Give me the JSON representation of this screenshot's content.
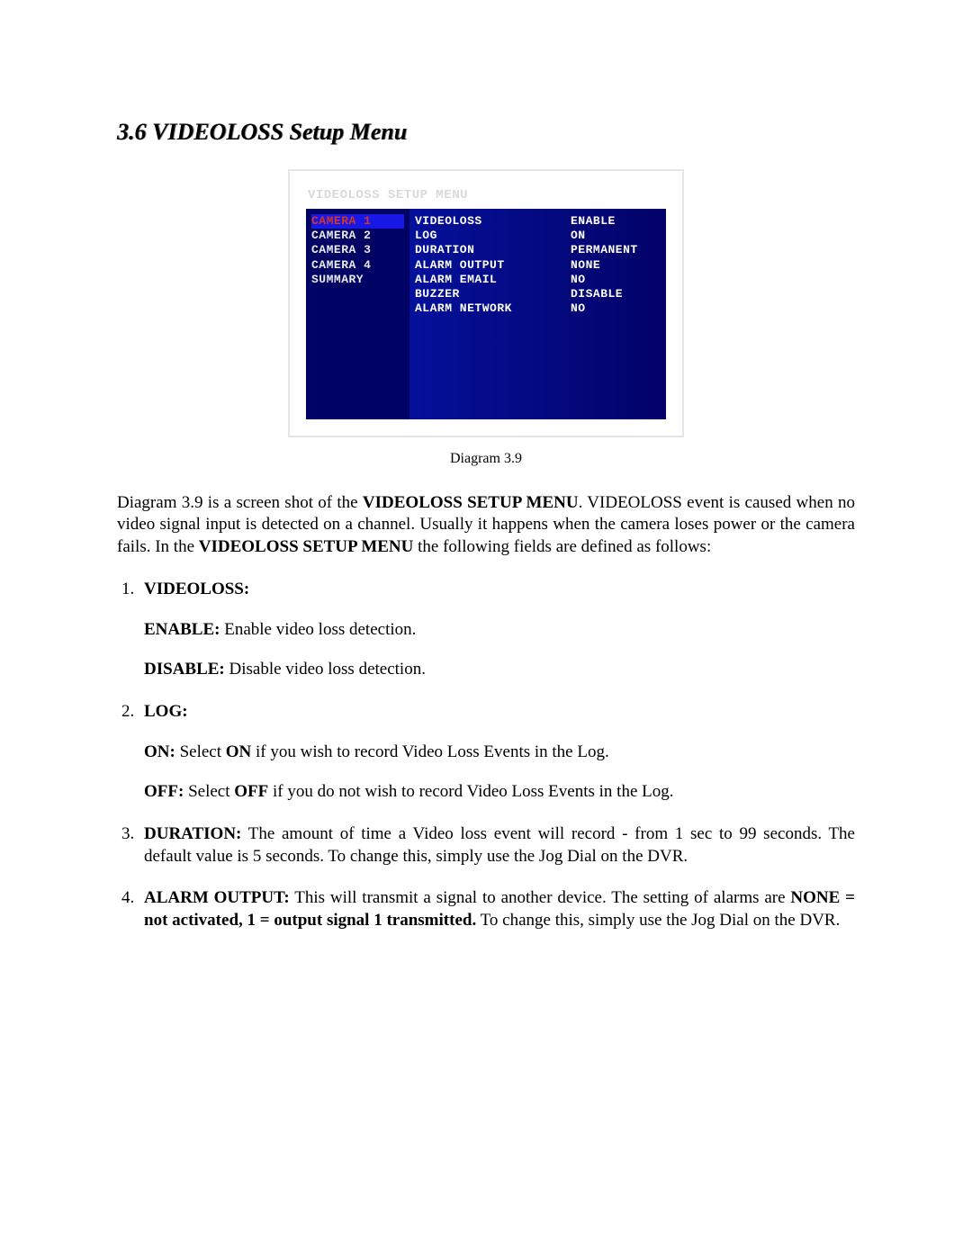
{
  "heading": "3.6 VIDEOLOSS Setup Menu",
  "menu": {
    "title": "VIDEOLOSS SETUP MENU",
    "left": [
      "CAMERA 1",
      "CAMERA 2",
      "CAMERA 3",
      "CAMERA 4",
      "SUMMARY"
    ],
    "rows": [
      {
        "field": "VIDEOLOSS",
        "value": "ENABLE"
      },
      {
        "field": "LOG",
        "value": "ON"
      },
      {
        "field": "DURATION",
        "value": "PERMANENT"
      },
      {
        "field": "ALARM OUTPUT",
        "value": "NONE"
      },
      {
        "field": "ALARM EMAIL",
        "value": "NO"
      },
      {
        "field": "BUZZER",
        "value": "DISABLE"
      },
      {
        "field": "ALARM NETWORK",
        "value": "NO"
      }
    ]
  },
  "caption": "Diagram 3.9",
  "intro": {
    "pre": "Diagram 3.9 is a screen shot of the ",
    "b1": "VIDEOLOSS SETUP MENU",
    "mid": ". VIDEOLOSS event is caused when no video signal input is detected on a channel. Usually it happens when the camera loses power or the camera fails. In the ",
    "b2": "VIDEOLOSS SETUP MENU",
    "post": " the following fields are defined as follows:"
  },
  "items": {
    "item1": {
      "title": "VIDEOLOSS:",
      "enable_label": "ENABLE:",
      "enable_text": " Enable video loss detection.",
      "disable_label": "DISABLE:",
      "disable_text": " Disable video loss detection."
    },
    "item2": {
      "title": "LOG:",
      "on_label": "ON:",
      "on_pre": " Select ",
      "on_b": "ON",
      "on_post": " if you wish to record Video Loss Events in the Log.",
      "off_label": "OFF:",
      "off_pre": " Select ",
      "off_b": "OFF",
      "off_post": " if you do not wish to record Video Loss Events in the Log."
    },
    "item3": {
      "title": "DURATION:",
      "text": " The amount of time a Video loss event will record - from 1 sec to 99 seconds. The default value is 5 seconds. To change this, simply use the Jog Dial on the DVR."
    },
    "item4": {
      "title": "ALARM OUTPUT:",
      "pre": " This will transmit a signal to another device. The setting of alarms are ",
      "b": "NONE = not activated, 1 = output signal 1 transmitted.",
      "post": " To change this, simply use the Jog Dial on the DVR."
    }
  }
}
